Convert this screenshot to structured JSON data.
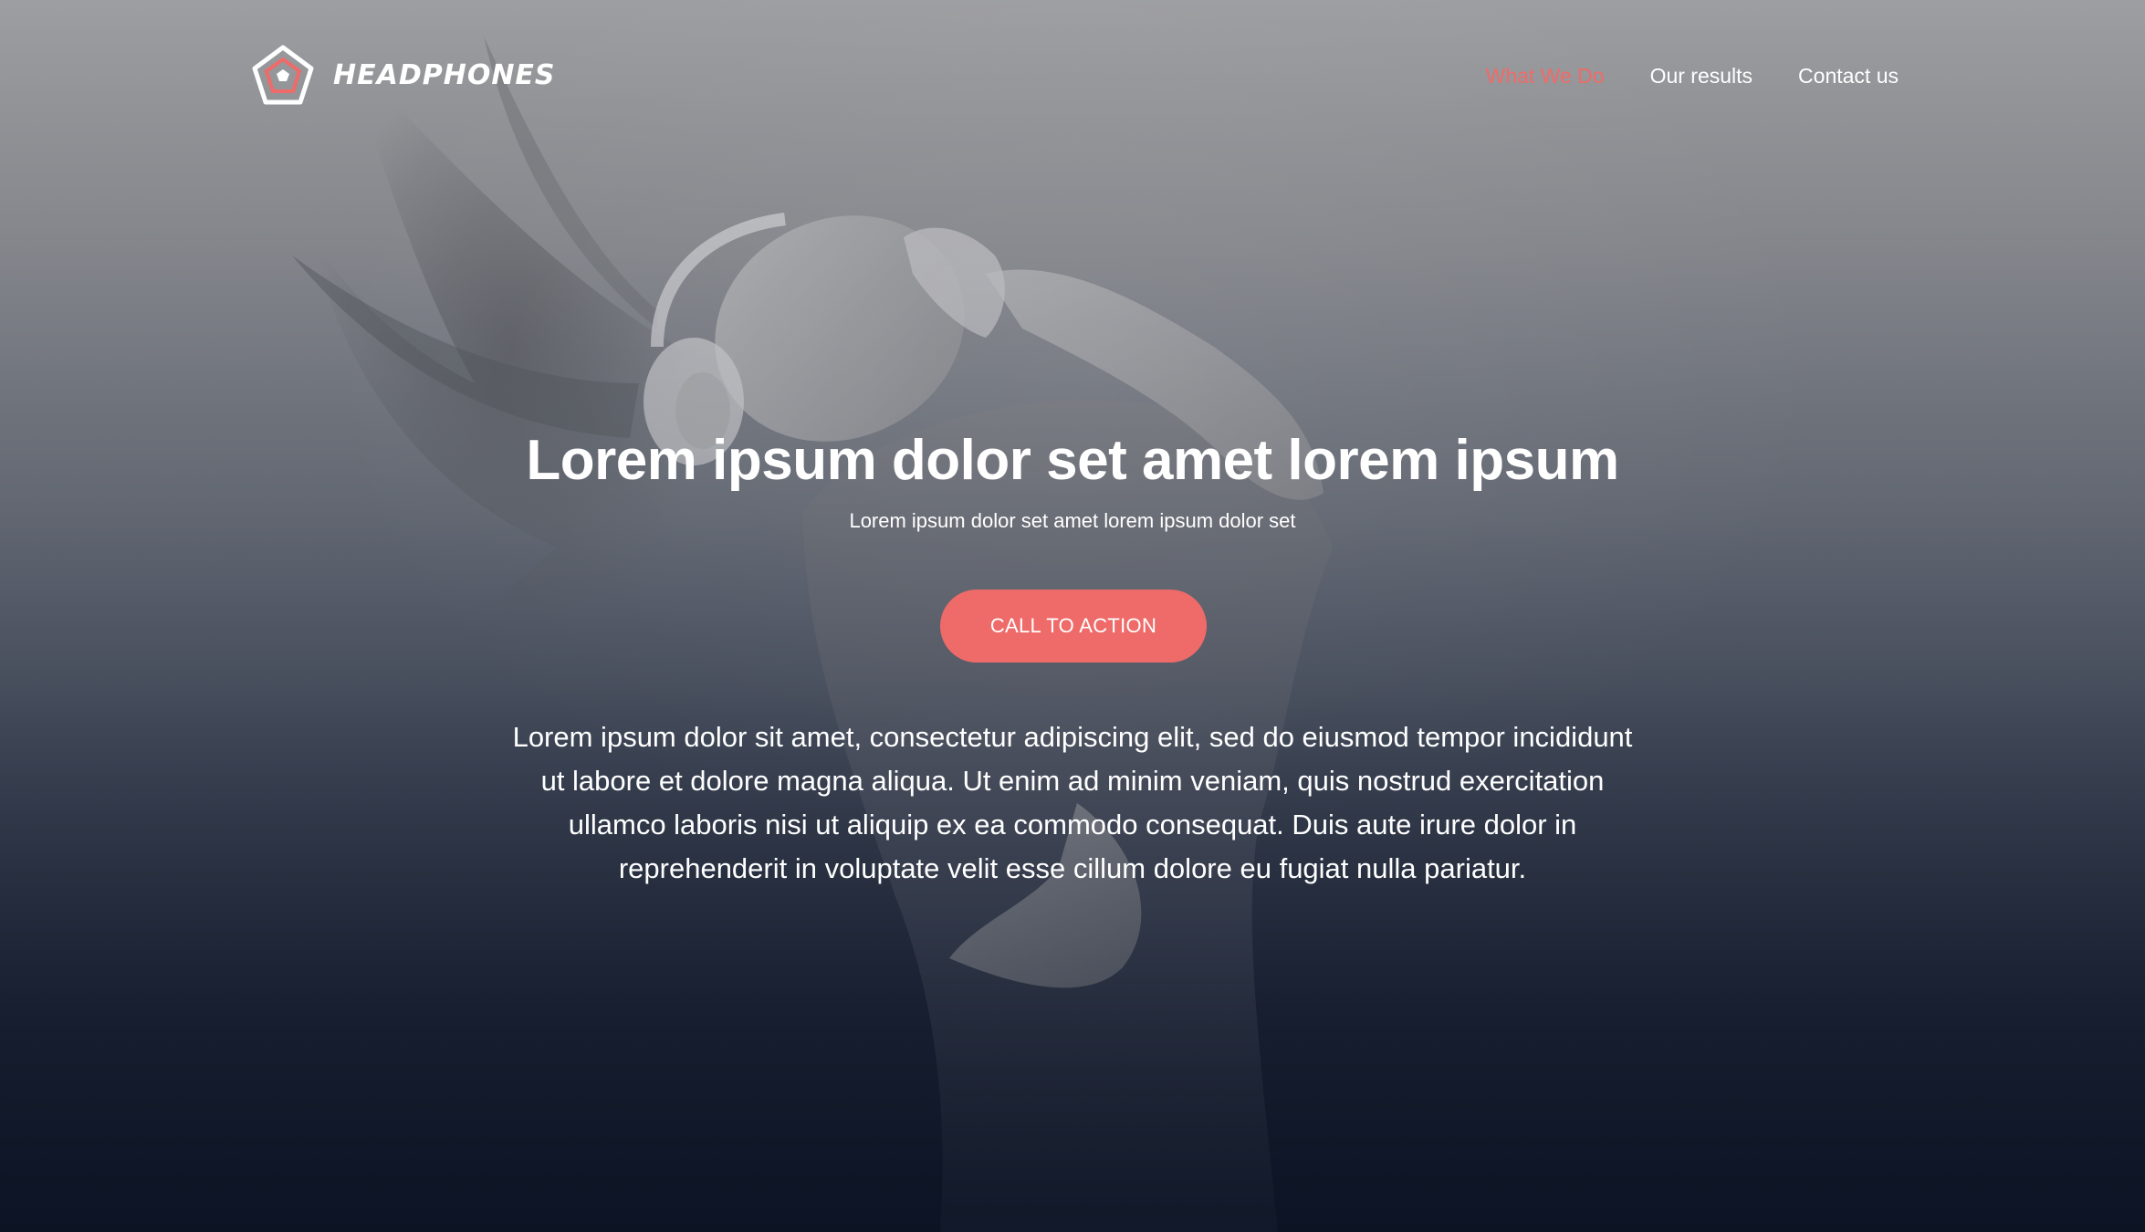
{
  "brand": {
    "name": "HEADPHONES",
    "logo_icon": "pentagon-logo-icon"
  },
  "nav": {
    "items": [
      {
        "label": "What We Do",
        "active": true
      },
      {
        "label": "Our results",
        "active": false
      },
      {
        "label": "Contact us",
        "active": false
      }
    ]
  },
  "hero": {
    "headline": "Lorem ipsum dolor set amet lorem ipsum",
    "subheadline": "Lorem ipsum dolor set amet lorem ipsum dolor set",
    "cta_label": "CALL TO ACTION",
    "body": "Lorem ipsum dolor sit amet, consectetur adipiscing elit, sed do eiusmod tempor incididunt ut labore et dolore magna aliqua. Ut enim ad minim veniam, quis nostrud exercitation ullamco laboris nisi ut aliquip ex ea commodo consequat. Duis aute irure dolor in reprehenderit in voluptate velit esse cillum dolore eu fugiat nulla pariatur."
  },
  "colors": {
    "accent": "#ee6b69",
    "text": "#ffffff",
    "background_top": "#9d9ea1",
    "background_bottom": "#0f1626"
  }
}
